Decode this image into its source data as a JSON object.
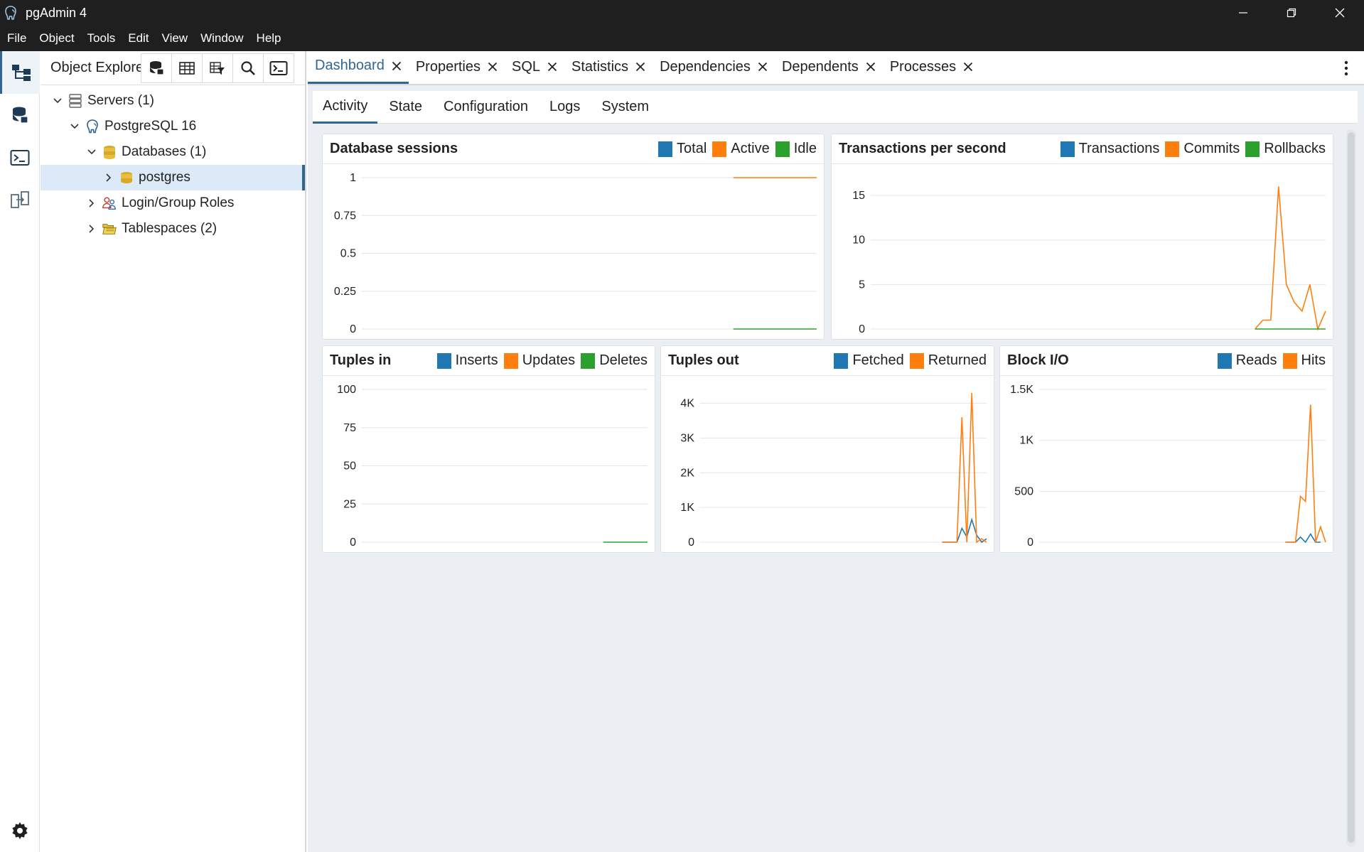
{
  "window": {
    "title": "pgAdmin 4"
  },
  "menu": [
    "File",
    "Object",
    "Tools",
    "Edit",
    "View",
    "Window",
    "Help"
  ],
  "explorer": {
    "title": "Object Explorer",
    "tree": [
      {
        "label": "Servers",
        "count": "(1)",
        "level": 0,
        "expanded": true,
        "icon": "servers-icon"
      },
      {
        "label": "PostgreSQL 16",
        "count": "",
        "level": 1,
        "expanded": true,
        "icon": "postgres-elephant-icon"
      },
      {
        "label": "Databases",
        "count": "(1)",
        "level": 2,
        "expanded": true,
        "icon": "databases-icon"
      },
      {
        "label": "postgres",
        "count": "",
        "level": 3,
        "expanded": false,
        "icon": "database-icon",
        "selected": true
      },
      {
        "label": "Login/Group Roles",
        "count": "",
        "level": 2,
        "expanded": false,
        "icon": "roles-icon"
      },
      {
        "label": "Tablespaces",
        "count": "(2)",
        "level": 2,
        "expanded": false,
        "icon": "tablespaces-icon"
      }
    ]
  },
  "tabs": [
    {
      "label": "Dashboard",
      "active": true
    },
    {
      "label": "Properties"
    },
    {
      "label": "SQL"
    },
    {
      "label": "Statistics"
    },
    {
      "label": "Dependencies"
    },
    {
      "label": "Dependents"
    },
    {
      "label": "Processes"
    }
  ],
  "subtabs": [
    {
      "label": "Activity",
      "active": true
    },
    {
      "label": "State"
    },
    {
      "label": "Configuration"
    },
    {
      "label": "Logs"
    },
    {
      "label": "System"
    }
  ],
  "colors": {
    "blue": "#1f77b4",
    "orange": "#ff7f0e",
    "green": "#2ca02c",
    "accent": "#326690"
  },
  "chart_data": [
    {
      "id": "sessions",
      "type": "line",
      "title": "Database sessions",
      "yticks": [
        "0",
        "0.25",
        "0.5",
        "0.75",
        "1"
      ],
      "ylim": [
        0,
        1.0
      ],
      "series": [
        {
          "name": "Total",
          "color": "#1f77b4",
          "values": []
        },
        {
          "name": "Active",
          "color": "#ff7f0e",
          "values": [
            null,
            null,
            null,
            null,
            null,
            null,
            null,
            null,
            null,
            null,
            null,
            null,
            null,
            null,
            null,
            null,
            null,
            null,
            null,
            null,
            null,
            null,
            null,
            null,
            null,
            null,
            null,
            null,
            null,
            null,
            null,
            null,
            null,
            null,
            null,
            null,
            null,
            null,
            null,
            null,
            null,
            null,
            null,
            null,
            null,
            null,
            null,
            null,
            null,
            1,
            1,
            1,
            1,
            1,
            1,
            1,
            1,
            1,
            1,
            1,
            1
          ]
        },
        {
          "name": "Idle",
          "color": "#2ca02c",
          "values": [
            null,
            null,
            null,
            null,
            null,
            null,
            null,
            null,
            null,
            null,
            null,
            null,
            null,
            null,
            null,
            null,
            null,
            null,
            null,
            null,
            null,
            null,
            null,
            null,
            null,
            null,
            null,
            null,
            null,
            null,
            null,
            null,
            null,
            null,
            null,
            null,
            null,
            null,
            null,
            null,
            null,
            null,
            null,
            null,
            null,
            null,
            null,
            null,
            null,
            0,
            0,
            0,
            0,
            0,
            0,
            0,
            0,
            0,
            0,
            0,
            0
          ]
        }
      ]
    },
    {
      "id": "tps",
      "type": "line",
      "title": "Transactions per second",
      "yticks": [
        "0",
        "5",
        "10",
        "15"
      ],
      "ylim": [
        0,
        17
      ],
      "series": [
        {
          "name": "Transactions",
          "color": "#1f77b4",
          "values": []
        },
        {
          "name": "Commits",
          "color": "#ff7f0e",
          "values": [
            null,
            null,
            null,
            null,
            null,
            null,
            null,
            null,
            null,
            null,
            null,
            null,
            null,
            null,
            null,
            null,
            null,
            null,
            null,
            null,
            null,
            null,
            null,
            null,
            null,
            null,
            null,
            null,
            null,
            null,
            null,
            null,
            null,
            null,
            null,
            null,
            null,
            null,
            null,
            null,
            null,
            null,
            null,
            null,
            null,
            null,
            null,
            null,
            null,
            0,
            1,
            1,
            16,
            5,
            3,
            2,
            5,
            0,
            2
          ]
        },
        {
          "name": "Rollbacks",
          "color": "#2ca02c",
          "values": [
            null,
            null,
            null,
            null,
            null,
            null,
            null,
            null,
            null,
            null,
            null,
            null,
            null,
            null,
            null,
            null,
            null,
            null,
            null,
            null,
            null,
            null,
            null,
            null,
            null,
            null,
            null,
            null,
            null,
            null,
            null,
            null,
            null,
            null,
            null,
            null,
            null,
            null,
            null,
            null,
            null,
            null,
            null,
            null,
            null,
            null,
            null,
            null,
            null,
            0,
            0,
            0,
            0,
            0,
            0,
            0,
            0,
            0,
            0
          ]
        }
      ]
    },
    {
      "id": "tuples_in",
      "type": "line",
      "title": "Tuples in",
      "yticks": [
        "0",
        "25",
        "50",
        "75",
        "100"
      ],
      "ylim": [
        0,
        100
      ],
      "series": [
        {
          "name": "Inserts",
          "color": "#1f77b4",
          "values": []
        },
        {
          "name": "Updates",
          "color": "#ff7f0e",
          "values": []
        },
        {
          "name": "Deletes",
          "color": "#2ca02c",
          "values": [
            null,
            null,
            null,
            null,
            null,
            null,
            null,
            null,
            null,
            null,
            null,
            null,
            null,
            null,
            null,
            null,
            null,
            null,
            null,
            null,
            null,
            null,
            null,
            null,
            null,
            null,
            null,
            null,
            null,
            null,
            null,
            null,
            null,
            null,
            null,
            null,
            null,
            null,
            null,
            null,
            null,
            null,
            null,
            null,
            null,
            null,
            null,
            null,
            null,
            0,
            0,
            0,
            0,
            0,
            0,
            0,
            0,
            0,
            0
          ]
        }
      ]
    },
    {
      "id": "tuples_out",
      "type": "line",
      "title": "Tuples out",
      "yticks": [
        "0",
        "1K",
        "2K",
        "3K",
        "4K"
      ],
      "ylim": [
        0,
        4400
      ],
      "series": [
        {
          "name": "Fetched",
          "color": "#1f77b4",
          "values": [
            null,
            null,
            null,
            null,
            null,
            null,
            null,
            null,
            null,
            null,
            null,
            null,
            null,
            null,
            null,
            null,
            null,
            null,
            null,
            null,
            null,
            null,
            null,
            null,
            null,
            null,
            null,
            null,
            null,
            null,
            null,
            null,
            null,
            null,
            null,
            null,
            null,
            null,
            null,
            null,
            null,
            null,
            null,
            null,
            null,
            null,
            null,
            null,
            null,
            0,
            0,
            0,
            0,
            400,
            150,
            650,
            200,
            0,
            100
          ]
        },
        {
          "name": "Returned",
          "color": "#ff7f0e",
          "values": [
            null,
            null,
            null,
            null,
            null,
            null,
            null,
            null,
            null,
            null,
            null,
            null,
            null,
            null,
            null,
            null,
            null,
            null,
            null,
            null,
            null,
            null,
            null,
            null,
            null,
            null,
            null,
            null,
            null,
            null,
            null,
            null,
            null,
            null,
            null,
            null,
            null,
            null,
            null,
            null,
            null,
            null,
            null,
            null,
            null,
            null,
            null,
            null,
            null,
            0,
            0,
            0,
            0,
            3600,
            0,
            4300,
            0,
            100,
            0
          ]
        }
      ]
    },
    {
      "id": "block_io",
      "type": "line",
      "title": "Block I/O",
      "yticks": [
        "0",
        "500",
        "1K",
        "1.5K"
      ],
      "ylim": [
        0,
        1500
      ],
      "series": [
        {
          "name": "Reads",
          "color": "#1f77b4",
          "values": [
            null,
            null,
            null,
            null,
            null,
            null,
            null,
            null,
            null,
            null,
            null,
            null,
            null,
            null,
            null,
            null,
            null,
            null,
            null,
            null,
            null,
            null,
            null,
            null,
            null,
            null,
            null,
            null,
            null,
            null,
            null,
            null,
            null,
            null,
            null,
            null,
            null,
            null,
            null,
            null,
            null,
            null,
            null,
            null,
            null,
            null,
            null,
            null,
            null,
            0,
            0,
            0,
            50,
            0,
            80,
            0,
            0
          ]
        },
        {
          "name": "Hits",
          "color": "#ff7f0e",
          "values": [
            null,
            null,
            null,
            null,
            null,
            null,
            null,
            null,
            null,
            null,
            null,
            null,
            null,
            null,
            null,
            null,
            null,
            null,
            null,
            null,
            null,
            null,
            null,
            null,
            null,
            null,
            null,
            null,
            null,
            null,
            null,
            null,
            null,
            null,
            null,
            null,
            null,
            null,
            null,
            null,
            null,
            null,
            null,
            null,
            null,
            null,
            null,
            null,
            null,
            0,
            0,
            0,
            450,
            400,
            1350,
            0,
            150,
            0
          ]
        }
      ]
    }
  ]
}
